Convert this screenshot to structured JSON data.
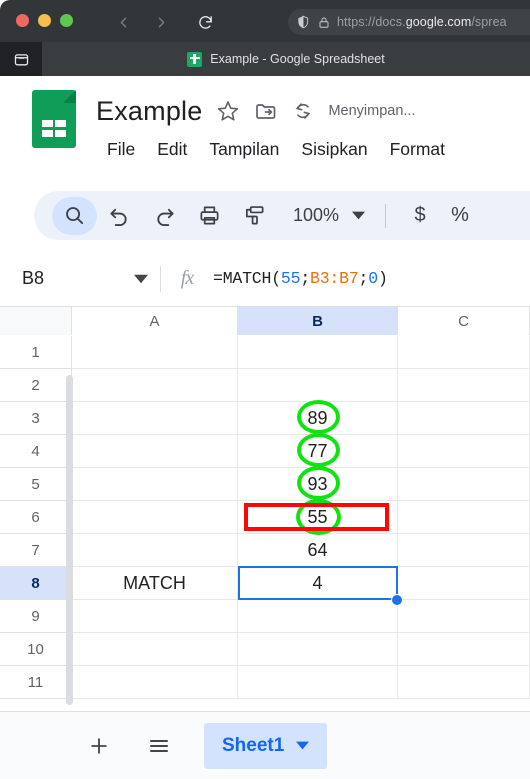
{
  "browser": {
    "back_icon": "chevron-left-icon",
    "forward_icon": "chevron-right-icon",
    "reload_icon": "reload-icon",
    "shield_icon": "shield-icon",
    "lock_icon": "lock-icon",
    "url_prefix": "https://docs.",
    "url_domain": "google.com",
    "url_suffix": "/sprea",
    "tab_list_icon": "tab-list-icon",
    "tab_title": "Example - Google Spreadsheet",
    "favicon": "google-sheets-icon"
  },
  "header": {
    "doc_logo": "google-sheets-logo",
    "doc_title": "Example",
    "star_icon": "star-icon",
    "move_icon": "move-to-folder-icon",
    "history_icon": "version-history-icon",
    "save_state": "Menyimpan...",
    "menus": [
      "File",
      "Edit",
      "Tampilan",
      "Sisipkan",
      "Format"
    ]
  },
  "toolbar": {
    "search_icon": "search-icon",
    "undo_icon": "undo-icon",
    "redo_icon": "redo-icon",
    "print_icon": "print-icon",
    "paint_format_icon": "paint-format-icon",
    "zoom_level": "100%",
    "zoom_caret_icon": "chevron-down-icon",
    "currency_label": "$",
    "percent_label": "%"
  },
  "formula_bar": {
    "name_box": "B8",
    "name_box_caret_icon": "chevron-down-icon",
    "fx_label": "fx",
    "formula_parts": [
      {
        "text": "=MATCH(",
        "kind": "plain"
      },
      {
        "text": "55",
        "kind": "number"
      },
      {
        "text": ";",
        "kind": "plain"
      },
      {
        "text": "B3:B7",
        "kind": "ref"
      },
      {
        "text": ";",
        "kind": "plain"
      },
      {
        "text": "0",
        "kind": "number"
      },
      {
        "text": ")",
        "kind": "plain"
      }
    ],
    "formula_plain": "=MATCH(55;B3:B7;0)"
  },
  "grid": {
    "columns": [
      "A",
      "B",
      "C"
    ],
    "selected_column": "B",
    "rows": [
      "1",
      "2",
      "3",
      "4",
      "5",
      "6",
      "7",
      "8",
      "9",
      "10",
      "11"
    ],
    "selected_row": "8",
    "cells": {
      "B3": "89",
      "B4": "77",
      "B5": "93",
      "B6": "55",
      "B7": "64",
      "A8": "MATCH",
      "B8": "4"
    },
    "selected_cell": "B8",
    "fill_handle": "fill-handle"
  },
  "annotations": {
    "highlight_color": "#12e212",
    "box_color": "#fc0606",
    "circled_cells": [
      "B3",
      "B4",
      "B5",
      "B6"
    ],
    "boxed_row": "6"
  },
  "sheet_bar": {
    "add_sheet_icon": "plus-icon",
    "all_sheets_icon": "hamburger-menu-icon",
    "tab_name": "Sheet1",
    "tab_caret_icon": "chevron-down-icon"
  },
  "colors": {
    "accent": "#1a73e8",
    "sheets_green": "#0f9d58",
    "selection_fill": "#d6e2f9"
  }
}
